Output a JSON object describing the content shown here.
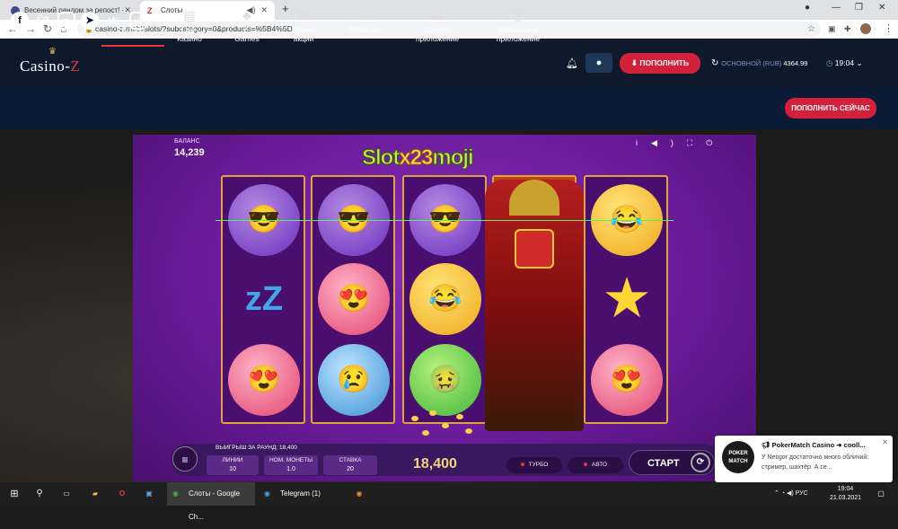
{
  "browser": {
    "tabs": [
      {
        "title": "Весенний рандом за репост! ·",
        "active": false
      },
      {
        "title": "Слоты",
        "active": true
      }
    ],
    "new_tab": "+",
    "url": "casino-z.mobi/slots/?subcategory=0&products=%5B4%5D"
  },
  "site": {
    "logo": "Casino-Z",
    "logo_main": "Casino-",
    "logo_z": "Z",
    "nav": [
      {
        "label": "Слоты",
        "icon": "bicycle-icon"
      },
      {
        "label": "Live-\nКазино",
        "icon": "cards-icon"
      },
      {
        "label": "Z-\nGames",
        "icon": "gamepad-icon"
      },
      {
        "label": "Промо\nакции",
        "icon": "gift-icon"
      },
      {
        "label": "Платежи",
        "icon": "wallet-icon"
      },
      {
        "label": "Десктоп\nприложение",
        "icon": "desktop-icon"
      },
      {
        "label": "Мобильное\nприложение",
        "icon": "phone-icon"
      }
    ],
    "deposit_button": "ПОПОЛНИТЬ",
    "balance_label": "ОСНОВНОЙ",
    "balance_currency": "(RUB)",
    "balance_amount": "4364.99",
    "clock": "19:04",
    "deposit_now_button": "ПОПОЛНИТЬ СЕЙЧАС",
    "social": [
      "facebook-icon",
      "twitter-icon",
      "instagram-icon",
      "telegram-icon",
      "vk-icon",
      "ok-icon"
    ]
  },
  "game": {
    "balance_label": "БАЛАНС",
    "balance_value": "14,239",
    "title_left": "Slot",
    "title_multiplier": "x23",
    "title_right": "moji",
    "reels": [
      [
        "cool-emoji",
        "zzz-symbol",
        "love-emoji"
      ],
      [
        "cool-emoji",
        "love-emoji",
        "sad-emoji"
      ],
      [
        "cool-emoji",
        "laugh-emoji",
        "sick-emoji"
      ],
      [
        "samurai-wild"
      ],
      [
        "laugh-emoji",
        "star-symbol",
        "love-emoji"
      ]
    ],
    "win_label": "ВЫИГРЫШ ЗА РАУНД: 18,400",
    "lines_label": "ЛИНИИ",
    "lines_value": "10",
    "coin_label": "НОМ. МОНЕТЫ",
    "coin_value": "1.0",
    "bet_label": "СТАВКА",
    "bet_value": "20",
    "big_win": "18,400",
    "turbo": "ТУРБО",
    "auto": "АВТО",
    "start": "СТАРТ"
  },
  "toast": {
    "title": "PokerMatch Casino ➜ cooll...",
    "body": "У Netigor достаточно много обличий: стример, шахтёр. А се...",
    "avatar_text": "POKER MATCH"
  },
  "taskbar": {
    "apps": [
      {
        "label": "Слоты - Google Ch...",
        "active": true
      },
      {
        "label": "Telegram (1)",
        "active": false
      }
    ],
    "lang": "РУС",
    "time": "19:04",
    "date": "21.03.2021"
  },
  "colors": {
    "accent": "#d4213a",
    "header": "#0e1a2c",
    "game_bg": "#6a1b9a"
  }
}
